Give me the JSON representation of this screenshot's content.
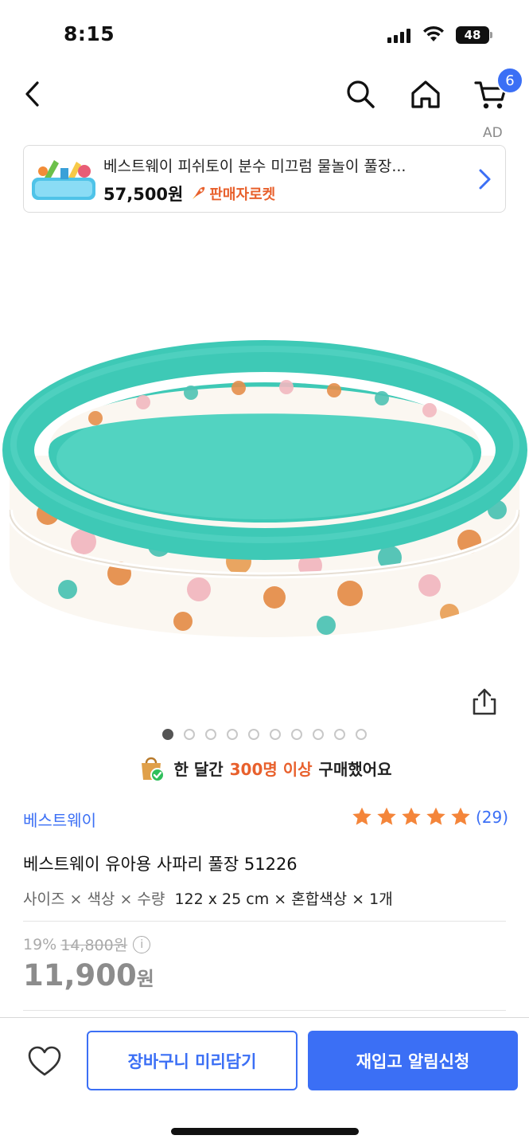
{
  "status_bar": {
    "time": "8:15",
    "battery": "48"
  },
  "nav": {
    "back_icon": "chevron-left-icon",
    "search_icon": "search-icon",
    "home_icon": "home-icon",
    "cart_icon": "cart-icon",
    "cart_count": "6",
    "ad_label": "AD"
  },
  "ad_banner": {
    "title": "베스트웨이 피쉬토이 분수 미끄럼 물놀이 풀장...",
    "price": "57,500원",
    "badge": "판매자로켓",
    "badge_icon": "rocket-icon"
  },
  "gallery": {
    "total_pages": 10,
    "current_page": 1
  },
  "purchase_banner": {
    "prefix": "한 달간",
    "highlight": "300명 이상",
    "suffix": "구매했어요"
  },
  "product": {
    "brand": "베스트웨이",
    "rating": 5,
    "review_count": "(29)",
    "title": "베스트웨이 유아용 사파리 풀장 51226",
    "option_label": "사이즈 × 색상 × 수량",
    "option_value": "122 x 25 cm × 혼합색상 × 1개",
    "discount_rate": "19%",
    "original_price": "14,800원",
    "sale_price": "11,900",
    "sale_unit": "원"
  },
  "bottom_bar": {
    "cart_button": "장바구니 미리담기",
    "notify_button": "재입고 알림신청"
  },
  "colors": {
    "accent": "#3b6ff5",
    "highlight": "#e8602c",
    "pool_teal": "#3ec9b6"
  }
}
